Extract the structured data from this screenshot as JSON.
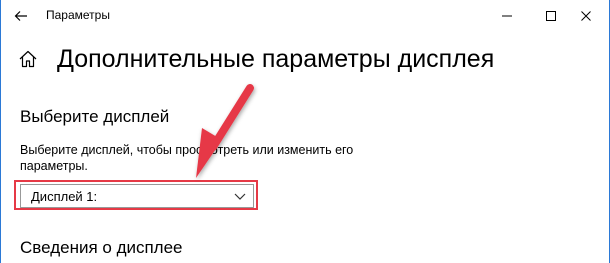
{
  "window": {
    "title": "Параметры",
    "icons": {
      "back": "back-arrow-icon",
      "minimize": "minimize-icon",
      "maximize": "maximize-icon",
      "close": "close-icon"
    }
  },
  "page": {
    "home_icon": "home-icon",
    "title": "Дополнительные параметры дисплея"
  },
  "choose_display": {
    "heading": "Выберите дисплей",
    "description": "Выберите дисплей, чтобы просмотреть или изменить его параметры.",
    "selected": "Дисплей 1:",
    "chevron_icon": "chevron-down-icon"
  },
  "display_info": {
    "heading": "Сведения о дисплее"
  },
  "colors": {
    "annotation": "#e63946",
    "border": "#999999"
  }
}
